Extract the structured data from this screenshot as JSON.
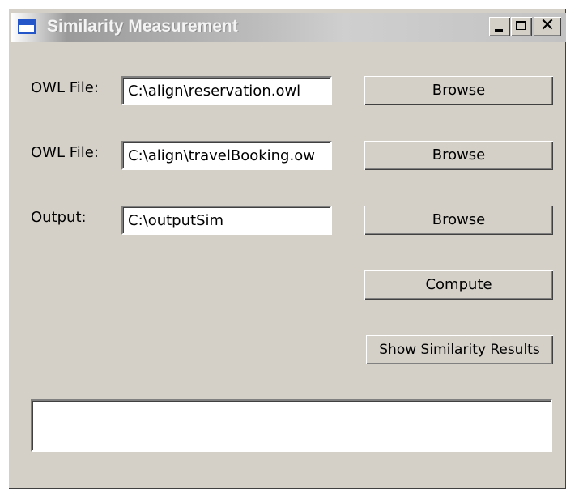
{
  "window": {
    "title": "Similarity Measurement",
    "close_glyph": "✕"
  },
  "form": {
    "owl_file_1": {
      "label": "OWL File:",
      "value": "C:\\align\\reservation.owl",
      "button": "Browse"
    },
    "owl_file_2": {
      "label": "OWL File:",
      "value": "C:\\align\\travelBooking.ow",
      "button": "Browse"
    },
    "output": {
      "label": "Output:",
      "value": "C:\\outputSim",
      "button": "Browse"
    }
  },
  "actions": {
    "compute": "Compute",
    "show_results": "Show Similarity Results"
  },
  "result_box": {
    "value": ""
  },
  "icons": {
    "title_icon": "window-icon",
    "minimize": "minimize-icon",
    "maximize": "maximize-icon",
    "close": "close-icon"
  }
}
